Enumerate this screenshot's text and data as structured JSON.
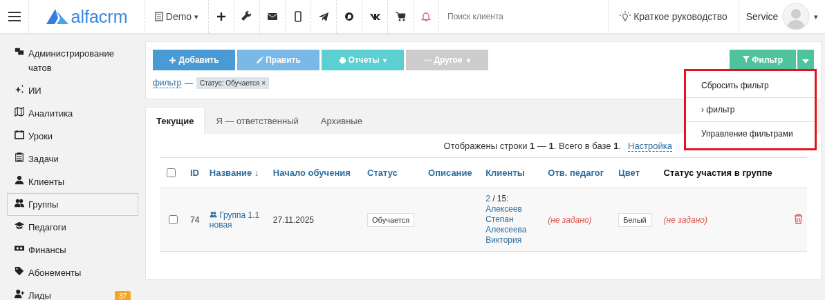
{
  "topbar": {
    "logo": "alfacrm",
    "branch": "Demo",
    "branch_caret": "▾",
    "search": {
      "placeholder": "Поиск клиента"
    },
    "guide": "Краткое руководство",
    "user": "Service",
    "user_caret": "▾"
  },
  "sidebar": {
    "items": [
      {
        "label": "Администрирование чатов",
        "selected": false
      },
      {
        "label": "ИИ",
        "selected": false
      },
      {
        "label": "Аналитика",
        "selected": false
      },
      {
        "label": "Уроки",
        "selected": false
      },
      {
        "label": "Задачи",
        "selected": false
      },
      {
        "label": "Клиенты",
        "selected": false
      },
      {
        "label": "Группы",
        "selected": true
      },
      {
        "label": "Педагоги",
        "selected": false
      },
      {
        "label": "Финансы",
        "selected": false
      },
      {
        "label": "Абонементы",
        "selected": false
      },
      {
        "label": "Лиды",
        "selected": false,
        "badge": "37"
      }
    ]
  },
  "toolbar": {
    "buttons": [
      {
        "label": "Добавить",
        "color": "#4a9bd5"
      },
      {
        "label": "Править",
        "color": "#7ab8e8"
      },
      {
        "label": "Отчеты",
        "color": "#5ccfd0",
        "caret": "▾"
      },
      {
        "label": "Другое",
        "color": "#cccccc",
        "caret": "▾"
      }
    ],
    "filter_button": "Фильтр",
    "filter_link": "фильтр",
    "separator": "—",
    "chip": "Статус: Обучается",
    "chip_remove": "×"
  },
  "filter_menu": {
    "highlighted": true,
    "items": [
      "Сбросить фильтр",
      "› фильтр",
      "Управление фильтрами"
    ]
  },
  "tabs": [
    {
      "label": "Текущие",
      "selected": true
    },
    {
      "label": "Я — ответственный",
      "selected": false
    },
    {
      "label": "Архивные",
      "selected": false
    }
  ],
  "summary": "Отображены строки **1** — **1**. Всего в базе **1**.",
  "settings_link": "Настройка",
  "table": {
    "all_checked": false,
    "columns": [
      {
        "label": "ID",
        "kind": "link"
      },
      {
        "label": "Название ↓",
        "kind": "link"
      },
      {
        "label": "Начало обучения",
        "kind": "link"
      },
      {
        "label": "Статус",
        "kind": "link"
      },
      {
        "label": "Описание",
        "kind": "link"
      },
      {
        "label": "Клиенты",
        "kind": "link"
      },
      {
        "label": "Отв. педагог",
        "kind": "link"
      },
      {
        "label": "Цвет",
        "kind": "link"
      },
      {
        "label": "Статус участия в группе",
        "kind": "plain"
      }
    ],
    "rows": [
      {
        "checked": false,
        "id": "74",
        "name": "Группа 1.1 новая",
        "start": "27.11.2025",
        "status": "Обучается",
        "clients_count": "2",
        "clients_total": " / 15:",
        "clients": [
          "Алексеев Степан",
          "Алексеева Виктория"
        ],
        "teacher": "(не задано)",
        "color_name": "Белый",
        "participation": "(не задано)"
      }
    ]
  }
}
